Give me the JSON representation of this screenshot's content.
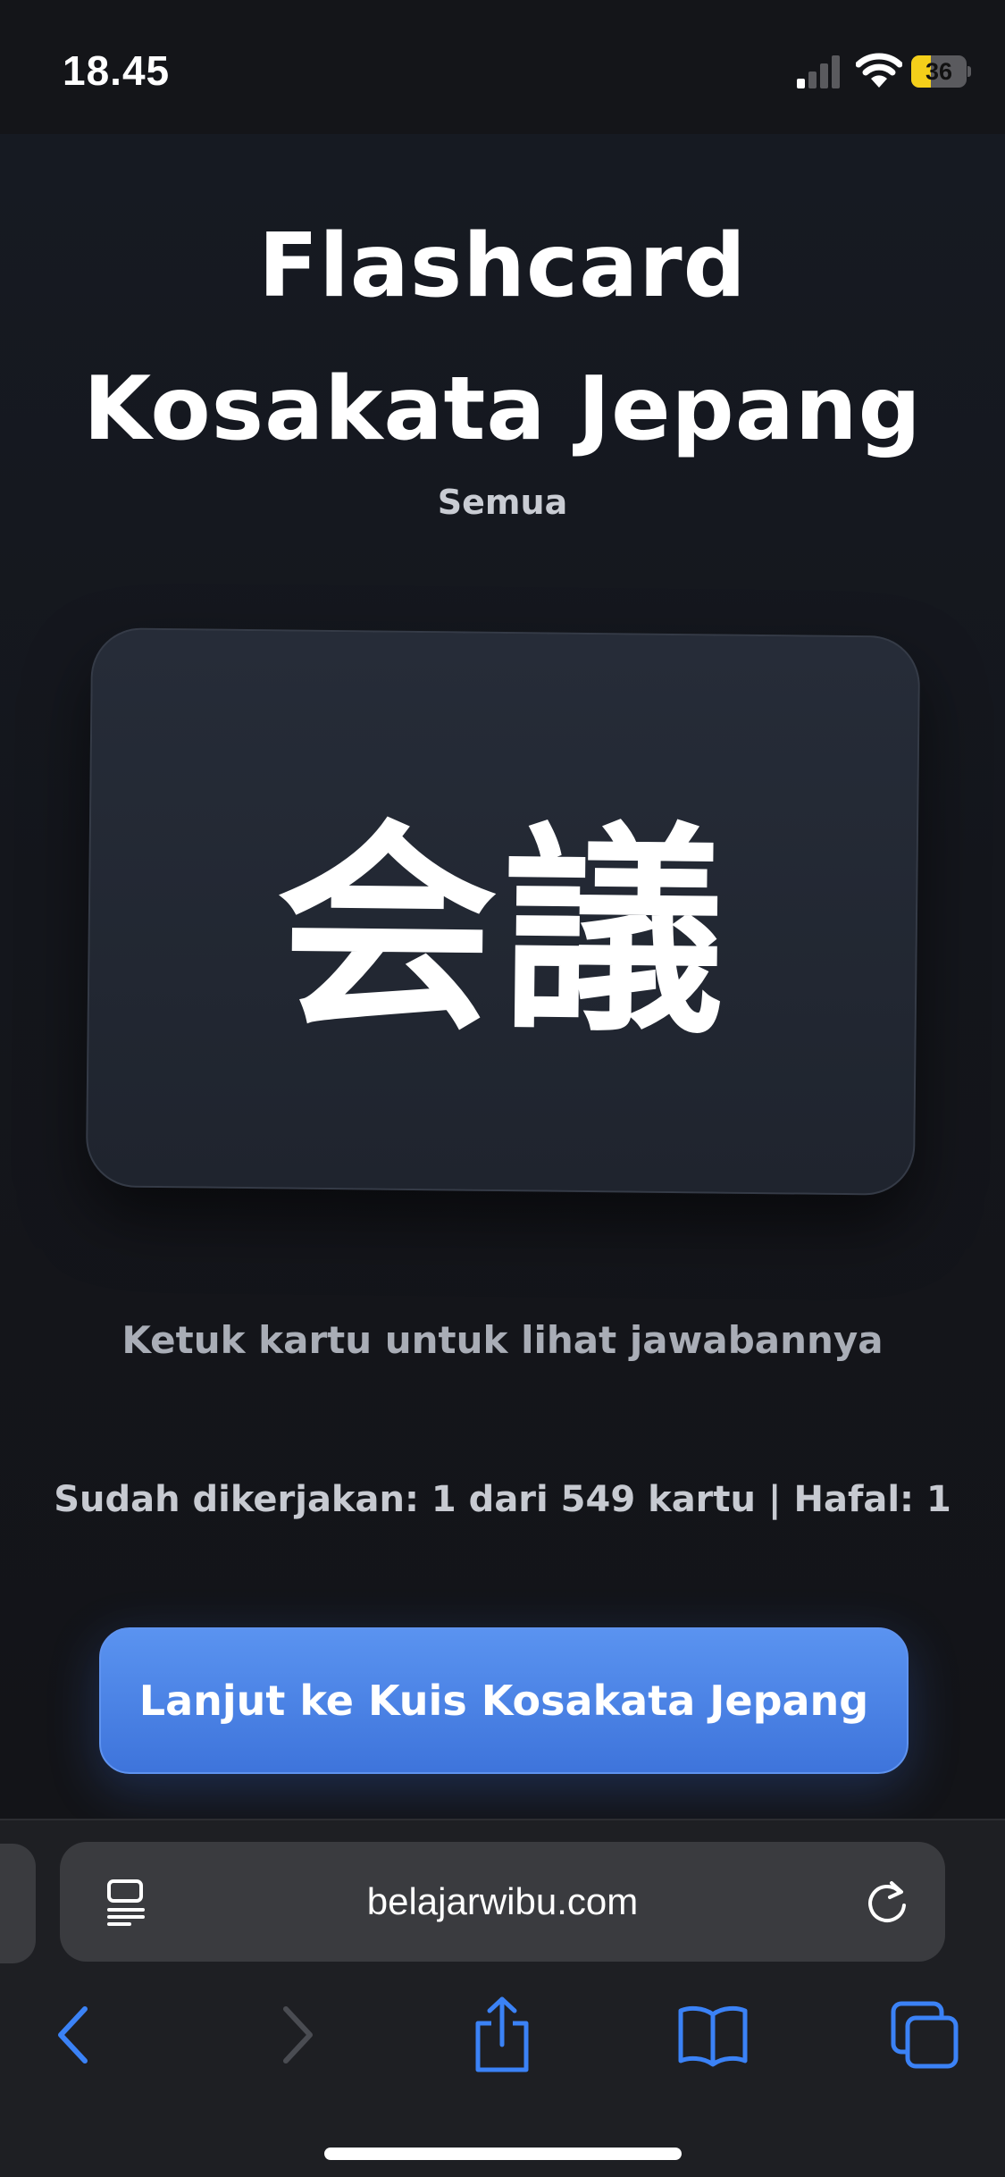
{
  "status_bar": {
    "time": "18.45",
    "battery_level": "36",
    "battery_fraction": 0.36,
    "battery_color": "#f4cf1a"
  },
  "page": {
    "title_line1": "Flashcard",
    "title_line2": "Kosakata Jepang",
    "subtitle": "Semua",
    "card_word": "会議",
    "hint": "Ketuk kartu untuk lihat jawabannya",
    "progress": "Sudah dikerjakan: 1 dari 549 kartu | Hafal: 1",
    "quiz_button_label": "Lanjut ke Kuis Kosakata Jepang",
    "accent_color": "#4a84e8"
  },
  "browser": {
    "url": "belajarwibu.com",
    "icons": [
      "reader-icon",
      "reload-icon",
      "back-icon",
      "forward-icon",
      "share-icon",
      "bookmarks-icon",
      "tabs-icon"
    ],
    "link_color": "#3b82f6"
  }
}
